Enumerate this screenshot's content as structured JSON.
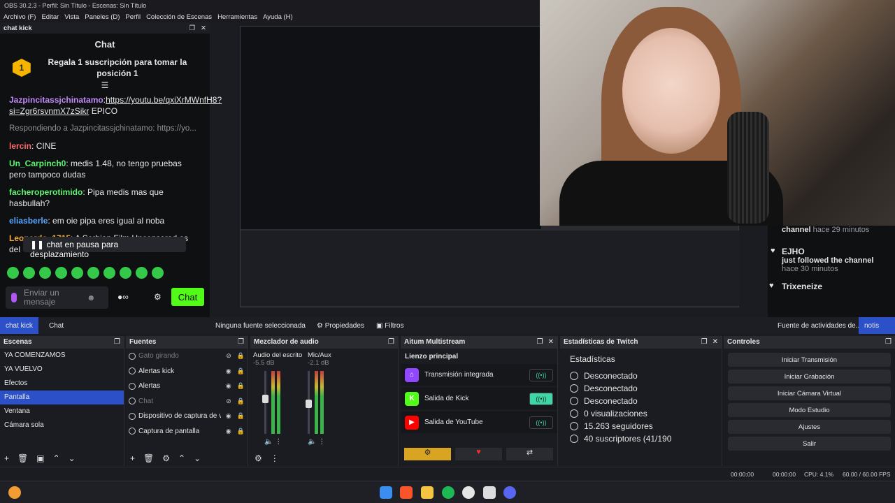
{
  "window": {
    "title": "OBS 30.2.3 - Perfil: Sin Título - Escenas: Sin Título"
  },
  "menu": [
    "Archivo (F)",
    "Editar",
    "Vista",
    "Paneles (D)",
    "Perfil",
    "Colección de Escenas",
    "Herramientas",
    "Ayuda (H)"
  ],
  "chat": {
    "dock_title": "chat kick",
    "title": "Chat",
    "gift_badge": "1",
    "gift_text": "Regala 1 suscripción para tomar la posición 1",
    "messages": [
      {
        "user": "Jazpincitassjchinatamo",
        "text": "https://youtu.be/qxiXrMWnfH8?si=Zgr6rsvnmX7zSikr",
        "suffix": " EPICO",
        "color": "#c18af7"
      },
      {
        "reply": "Respondiendo a Jazpincitassjchinatamo: https://yo..."
      },
      {
        "user": "lercin",
        "text": " CINE",
        "color": "#ff6a6a"
      },
      {
        "user": "Un_Carpinch0",
        "text": " medis 1.48, no tengo pruebas pero tampoco dudas",
        "color": "#5df56f"
      },
      {
        "user": "facheroperotimido",
        "text": " Pipa medis mas que hasbullah?",
        "color": "#5df56f"
      },
      {
        "user": "eliasberle",
        "text": " em oie pipa eres igual al noba",
        "color": "#5aa6ff"
      },
      {
        "user": "Leonardo_1715",
        "text": " A Serbian Film Uncensored es del",
        "color": "#f2a93b"
      }
    ],
    "pause_text": "chat en pausa para desplazamiento",
    "input_placeholder": "Enviar un mensaje",
    "send_label": "Chat"
  },
  "activity": {
    "items": [
      {
        "name": "channel",
        "time": "hace 29 minutos"
      },
      {
        "name": "EJHO",
        "event": "just followed the channel",
        "time": "hace 30 minutos"
      },
      {
        "name": "Trixeneize"
      }
    ]
  },
  "tabs": {
    "left": [
      "chat kick",
      "Chat"
    ],
    "source_label": "Ninguna fuente seleccionada",
    "props": "Propiedades",
    "filters": "Filtros",
    "right": [
      "Fuente de actividades de...",
      "notis"
    ]
  },
  "scenes": {
    "title": "Escenas",
    "items": [
      "YA COMENZAMOS",
      "YA VUELVO",
      "Efectos",
      "Pantalla",
      "Ventana",
      "Cámara sola"
    ],
    "selected": 3
  },
  "sources": {
    "title": "Fuentes",
    "items": [
      {
        "name": "Gato girando",
        "dim": true
      },
      {
        "name": "Alertas kick",
        "dim": false
      },
      {
        "name": "Alertas",
        "dim": false
      },
      {
        "name": "Chat",
        "dim": true
      },
      {
        "name": "Dispositivo de captura de vide",
        "dim": false
      },
      {
        "name": "Captura de pantalla",
        "dim": false
      }
    ]
  },
  "mixer": {
    "title": "Mezclador de audio",
    "channels": [
      {
        "name": "Audio del escrito",
        "db": "-5.5 dB",
        "level": 0.62
      },
      {
        "name": "Mic/Aux",
        "db": "-2.1 dB",
        "level": 0.55
      }
    ]
  },
  "multistream": {
    "title": "Aitum Multistream",
    "canvas": "Lienzo principal",
    "outputs": [
      {
        "name": "Transmisión integrada",
        "icon": "twitch-icon",
        "color": "#9146ff",
        "on": false
      },
      {
        "name": "Salida de Kick",
        "icon": "kick-icon",
        "color": "#53fc18",
        "on": true
      },
      {
        "name": "Salida de YouTube",
        "icon": "youtube-icon",
        "color": "#ff0000",
        "on": false
      }
    ]
  },
  "twitch_stats": {
    "title": "Estadísticas de Twitch",
    "heading": "Estadísticas",
    "rows": [
      "Desconectado",
      "Desconectado",
      "Desconectado",
      "0 visualizaciones",
      "15.263 seguidores",
      "40 suscriptores (41/190"
    ]
  },
  "controls": {
    "title": "Controles",
    "buttons": [
      "Iniciar Transmisión",
      "Iniciar Grabación",
      "Iniciar Cámara Virtual",
      "Modo Estudio",
      "Ajustes",
      "Salir"
    ]
  },
  "status": {
    "time1": "00:00:00",
    "time2": "00:00:00",
    "cpu": "CPU: 4.1%",
    "fps": "60.00 / 60.00 FPS"
  }
}
